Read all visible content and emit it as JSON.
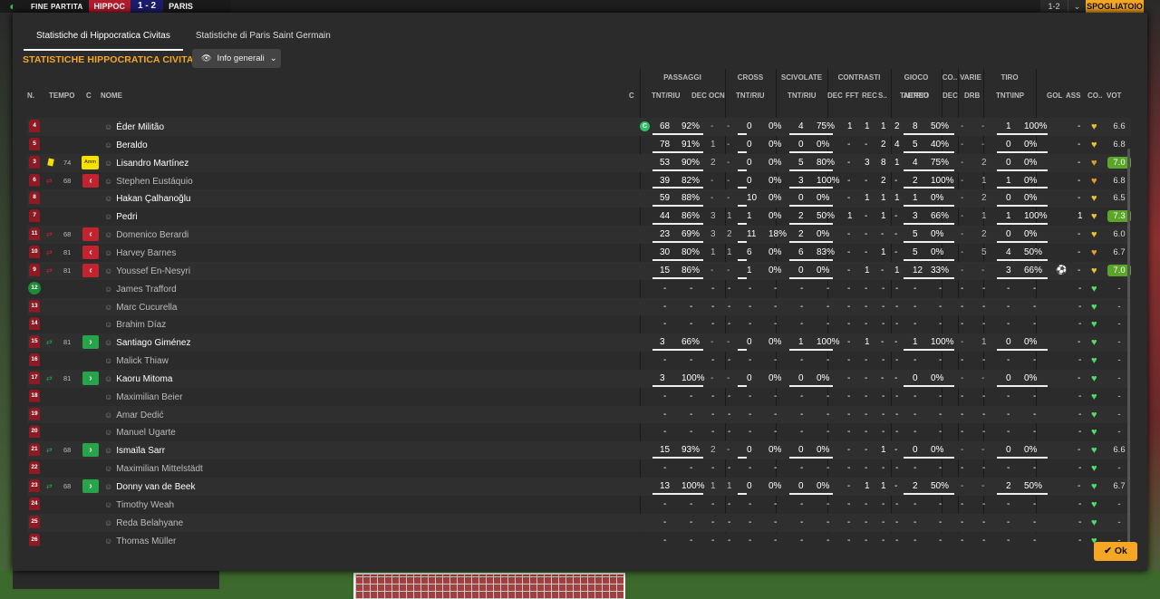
{
  "scorebar": {
    "label": "FINE PARTITA",
    "home": "HIPPOC",
    "score": "1 - 2",
    "away": "PARIS"
  },
  "topright": {
    "score": "1-2",
    "chev": "⌄",
    "button": "SPOGLIATOIO"
  },
  "tabs": [
    "Statistiche di Hippocratica Civitas",
    "Statistiche di Paris Saint Germain"
  ],
  "title": "STATISTICHE HIPPOCRATICA CIVITAS",
  "dropdown": "Info generali",
  "groups": [
    "PASSAGGI",
    "CROSS",
    "SCIVOLATE",
    "CONTRASTI",
    "GIOCO AEREO",
    "CO..",
    "VARIE",
    "TIRO"
  ],
  "headers": {
    "n": "N.",
    "tempo": "TEMPO",
    "c": "C",
    "nome": "NOME",
    "c2": "C",
    "pass_tnt": "TNT/RIU",
    "pass_dec": "DEC",
    "pass_ocn": "OCN",
    "cross_tnt": "TNT/RIU",
    "sciv_tnt": "TNT/RIU",
    "con_dec": "DEC",
    "con_fft": "FFT",
    "con_rec": "REC",
    "con_s": "S..",
    "aereo_tnt": "TNT/RIU",
    "co_dec": "DEC",
    "varie_drb": "DRB",
    "tiro_tnt": "TNT\\INP",
    "gol": "GOL",
    "ass": "ASS",
    "cond": "CO..",
    "vot": "VOT"
  },
  "players": [
    {
      "n": "4",
      "name": "Éder Militão",
      "tempo": "",
      "event": "",
      "c_badge": "C",
      "p": [
        "68",
        "92%"
      ],
      "pd": "-",
      "po": "-",
      "cr": [
        "0",
        "0%"
      ],
      "sc": [
        "4",
        "75%"
      ],
      "con": [
        "1",
        "1",
        "1",
        "2"
      ],
      "ae": [
        "8",
        "50%"
      ],
      "cd": "-",
      "drb": "-",
      "ti": [
        "1",
        "100%"
      ],
      "gol": "",
      "ass": "-",
      "heart": "y",
      "vot": "6.6",
      "green": false
    },
    {
      "n": "5",
      "name": "Beraldo",
      "tempo": "",
      "event": "",
      "p": [
        "78",
        "91%"
      ],
      "pd": "1",
      "po": "-",
      "cr": [
        "0",
        "0%"
      ],
      "sc": [
        "0",
        "0%"
      ],
      "con": [
        "-",
        "-",
        "2",
        "4"
      ],
      "ae": [
        "5",
        "40%"
      ],
      "cd": "-",
      "drb": "-",
      "ti": [
        "0",
        "0%"
      ],
      "gol": "",
      "ass": "-",
      "heart": "y",
      "vot": "6.8",
      "green": false
    },
    {
      "n": "3",
      "name": "Lisandro Martínez",
      "tempo": "74",
      "event": "amm",
      "amm": "Amm",
      "p": [
        "53",
        "90%"
      ],
      "pd": "2",
      "po": "-",
      "cr": [
        "0",
        "0%"
      ],
      "sc": [
        "5",
        "80%"
      ],
      "con": [
        "-",
        "3",
        "8",
        "1"
      ],
      "ae": [
        "4",
        "75%"
      ],
      "cd": "-",
      "drb": "2",
      "ti": [
        "0",
        "0%"
      ],
      "gol": "",
      "ass": "-",
      "heart": "o",
      "vot": "7.0",
      "green": true
    },
    {
      "n": "6",
      "name": "Stephen Eustáquio",
      "tempo": "68",
      "event": "out",
      "p": [
        "39",
        "82%"
      ],
      "pd": "-",
      "po": "-",
      "cr": [
        "0",
        "0%"
      ],
      "sc": [
        "3",
        "100%"
      ],
      "con": [
        "-",
        "-",
        "2",
        "-"
      ],
      "ae": [
        "2",
        "100%"
      ],
      "cd": "-",
      "drb": "1",
      "ti": [
        "1",
        "0%"
      ],
      "gol": "",
      "ass": "-",
      "heart": "o",
      "vot": "6.8",
      "green": false,
      "dim": true
    },
    {
      "n": "8",
      "name": "Hakan Çalhanoğlu",
      "tempo": "",
      "event": "",
      "p": [
        "59",
        "88%"
      ],
      "pd": "-",
      "po": "-",
      "cr": [
        "10",
        "0%"
      ],
      "sc": [
        "0",
        "0%"
      ],
      "con": [
        "-",
        "1",
        "1",
        "1"
      ],
      "ae": [
        "1",
        "0%"
      ],
      "cd": "-",
      "drb": "2",
      "ti": [
        "0",
        "0%"
      ],
      "gol": "",
      "ass": "-",
      "heart": "y",
      "vot": "6.5",
      "green": false
    },
    {
      "n": "7",
      "name": "Pedri",
      "tempo": "",
      "event": "",
      "p": [
        "44",
        "86%"
      ],
      "pd": "3",
      "po": "1",
      "cr": [
        "1",
        "0%"
      ],
      "sc": [
        "2",
        "50%"
      ],
      "con": [
        "1",
        "-",
        "1",
        "-"
      ],
      "ae": [
        "3",
        "66%"
      ],
      "cd": "-",
      "drb": "1",
      "ti": [
        "1",
        "100%"
      ],
      "gol": "",
      "ass": "1",
      "heart": "y",
      "vot": "7.3",
      "green": true
    },
    {
      "n": "11",
      "name": "Domenico Berardi",
      "tempo": "68",
      "event": "out",
      "p": [
        "23",
        "69%"
      ],
      "pd": "3",
      "po": "2",
      "cr": [
        "11",
        "18%"
      ],
      "sc": [
        "2",
        "0%"
      ],
      "con": [
        "-",
        "-",
        "-",
        "-"
      ],
      "ae": [
        "5",
        "0%"
      ],
      "cd": "-",
      "drb": "2",
      "ti": [
        "0",
        "0%"
      ],
      "gol": "",
      "ass": "-",
      "heart": "y",
      "vot": "6.0",
      "green": false,
      "dim": true
    },
    {
      "n": "10",
      "name": "Harvey Barnes",
      "tempo": "81",
      "event": "out",
      "p": [
        "30",
        "80%"
      ],
      "pd": "1",
      "po": "1",
      "cr": [
        "6",
        "0%"
      ],
      "sc": [
        "6",
        "83%"
      ],
      "con": [
        "-",
        "-",
        "1",
        "-"
      ],
      "ae": [
        "5",
        "0%"
      ],
      "cd": "-",
      "drb": "5",
      "ti": [
        "4",
        "50%"
      ],
      "gol": "",
      "ass": "-",
      "heart": "o",
      "vot": "6.7",
      "green": false,
      "dim": true
    },
    {
      "n": "9",
      "name": "Youssef En-Nesyri",
      "tempo": "81",
      "event": "out",
      "p": [
        "15",
        "86%"
      ],
      "pd": "-",
      "po": "-",
      "cr": [
        "1",
        "0%"
      ],
      "sc": [
        "0",
        "0%"
      ],
      "con": [
        "-",
        "1",
        "-",
        "1"
      ],
      "ae": [
        "12",
        "33%"
      ],
      "cd": "-",
      "drb": "-",
      "ti": [
        "3",
        "66%"
      ],
      "gol": "⚽",
      "ass": "-",
      "heart": "y",
      "vot": "7.0",
      "green": true,
      "dim": true
    },
    {
      "n": "12",
      "name": "James Trafford",
      "gk": true,
      "tempo": "",
      "event": "",
      "empty": true,
      "heart": "g",
      "vot": "-",
      "dim": true
    },
    {
      "n": "13",
      "name": "Marc Cucurella",
      "tempo": "",
      "event": "",
      "empty": true,
      "heart": "g",
      "vot": "-",
      "dim": true
    },
    {
      "n": "14",
      "name": "Brahim Díaz",
      "tempo": "",
      "event": "",
      "empty": true,
      "heart": "g",
      "vot": "-",
      "dim": true
    },
    {
      "n": "15",
      "name": "Santiago Giménez",
      "tempo": "81",
      "event": "in",
      "p": [
        "3",
        "66%"
      ],
      "pd": "-",
      "po": "-",
      "cr": [
        "0",
        "0%"
      ],
      "sc": [
        "1",
        "100%"
      ],
      "con": [
        "-",
        "1",
        "-",
        "-"
      ],
      "ae": [
        "1",
        "100%"
      ],
      "cd": "-",
      "drb": "1",
      "ti": [
        "0",
        "0%"
      ],
      "gol": "",
      "ass": "-",
      "heart": "g",
      "vot": "-",
      "green": false
    },
    {
      "n": "16",
      "name": "Malick Thiaw",
      "tempo": "",
      "event": "",
      "empty": true,
      "heart": "g",
      "vot": "-",
      "dim": true
    },
    {
      "n": "17",
      "name": "Kaoru Mitoma",
      "tempo": "81",
      "event": "in",
      "p": [
        "3",
        "100%"
      ],
      "pd": "-",
      "po": "-",
      "cr": [
        "0",
        "0%"
      ],
      "sc": [
        "0",
        "0%"
      ],
      "con": [
        "-",
        "-",
        "-",
        "-"
      ],
      "ae": [
        "0",
        "0%"
      ],
      "cd": "-",
      "drb": "-",
      "ti": [
        "0",
        "0%"
      ],
      "gol": "",
      "ass": "-",
      "heart": "g",
      "vot": "-",
      "green": false
    },
    {
      "n": "18",
      "name": "Maximilian Beier",
      "tempo": "",
      "event": "",
      "empty": true,
      "heart": "g",
      "vot": "-",
      "dim": true
    },
    {
      "n": "19",
      "name": "Amar Dedić",
      "tempo": "",
      "event": "",
      "empty": true,
      "heart": "g",
      "vot": "-",
      "dim": true
    },
    {
      "n": "20",
      "name": "Manuel Ugarte",
      "tempo": "",
      "event": "",
      "empty": true,
      "heart": "g",
      "vot": "-",
      "dim": true
    },
    {
      "n": "21",
      "name": "Ismaïla Sarr",
      "tempo": "68",
      "event": "in",
      "p": [
        "15",
        "93%"
      ],
      "pd": "2",
      "po": "-",
      "cr": [
        "0",
        "0%"
      ],
      "sc": [
        "0",
        "0%"
      ],
      "con": [
        "-",
        "-",
        "1",
        "-"
      ],
      "ae": [
        "0",
        "0%"
      ],
      "cd": "-",
      "drb": "-",
      "ti": [
        "0",
        "0%"
      ],
      "gol": "",
      "ass": "-",
      "heart": "g",
      "vot": "6.6",
      "green": false
    },
    {
      "n": "22",
      "name": "Maximilian Mittelstädt",
      "tempo": "",
      "event": "",
      "empty": true,
      "heart": "g",
      "vot": "-",
      "dim": true
    },
    {
      "n": "23",
      "name": "Donny van de Beek",
      "tempo": "68",
      "event": "in",
      "p": [
        "13",
        "100%"
      ],
      "pd": "1",
      "po": "1",
      "cr": [
        "0",
        "0%"
      ],
      "sc": [
        "0",
        "0%"
      ],
      "con": [
        "-",
        "1",
        "1",
        "-"
      ],
      "ae": [
        "2",
        "50%"
      ],
      "cd": "-",
      "drb": "-",
      "ti": [
        "2",
        "50%"
      ],
      "gol": "",
      "ass": "-",
      "heart": "g",
      "vot": "6.7",
      "green": false
    },
    {
      "n": "24",
      "name": "Timothy Weah",
      "tempo": "",
      "event": "",
      "empty": true,
      "heart": "g",
      "vot": "-",
      "dim": true
    },
    {
      "n": "25",
      "name": "Reda Belahyane",
      "tempo": "",
      "event": "",
      "empty": true,
      "heart": "g",
      "vot": "-",
      "dim": true
    },
    {
      "n": "26",
      "name": "Thomas Müller",
      "tempo": "",
      "event": "",
      "empty": true,
      "heart": "g",
      "vot": "-",
      "dim": true
    }
  ],
  "ok": "Ok"
}
